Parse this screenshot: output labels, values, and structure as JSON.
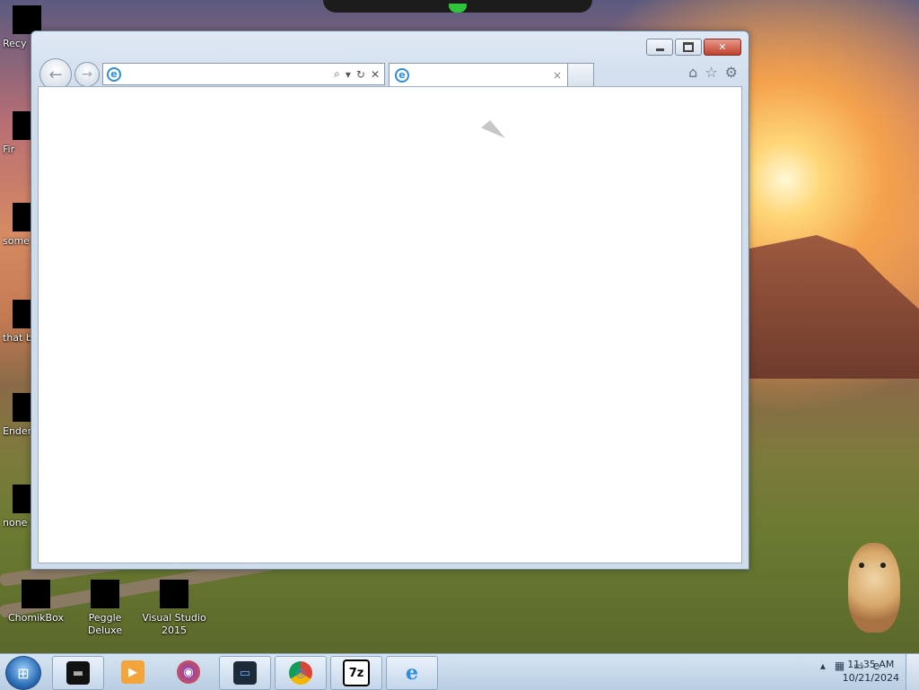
{
  "desktop": {
    "icons": [
      {
        "label": "Recy"
      },
      {
        "label": "Fir"
      },
      {
        "label": "some ran"
      },
      {
        "label": "that b"
      },
      {
        "label": "Ender"
      },
      {
        "label": "none retarc"
      },
      {
        "label": "ChomikBox"
      },
      {
        "label": "Peggle Deluxe"
      },
      {
        "label": "Visual Studio 2015"
      }
    ]
  },
  "browser": {
    "caption_buttons": {
      "minimize": "",
      "maximize": "",
      "close": "✕"
    },
    "nav": {
      "back": "←",
      "forward": "→"
    },
    "address": {
      "value": "",
      "placeholder": "",
      "search_glyph": "⌕",
      "dropdown_glyph": "▾",
      "refresh_glyph": "↻",
      "stop_glyph": "✕"
    },
    "tab": {
      "title": "",
      "close_glyph": "×"
    },
    "cmd": {
      "home": "⌂",
      "favorites": "☆",
      "tools": "⚙"
    }
  },
  "taskbar": {
    "start_glyph": "⊞",
    "items": [
      {
        "name": "terminal",
        "glyph": "▬"
      },
      {
        "name": "media-player",
        "glyph": "▶"
      },
      {
        "name": "firefox",
        "glyph": "◉"
      },
      {
        "name": "remote-desktop",
        "glyph": "▭"
      },
      {
        "name": "chrome",
        "glyph": "◎"
      },
      {
        "name": "7zip",
        "glyph": "7z"
      },
      {
        "name": "internet-explorer",
        "glyph": "e"
      }
    ],
    "tray": {
      "chevron": "▴",
      "network": "▦",
      "monitor": "▭",
      "ie": "e"
    },
    "clock": {
      "time": "11:35 AM",
      "date": "10/21/2024"
    }
  },
  "colors": {
    "ie_blue": "#2d8ce0",
    "close_red": "#c0412d",
    "taskbar": "#c4d6ea"
  }
}
